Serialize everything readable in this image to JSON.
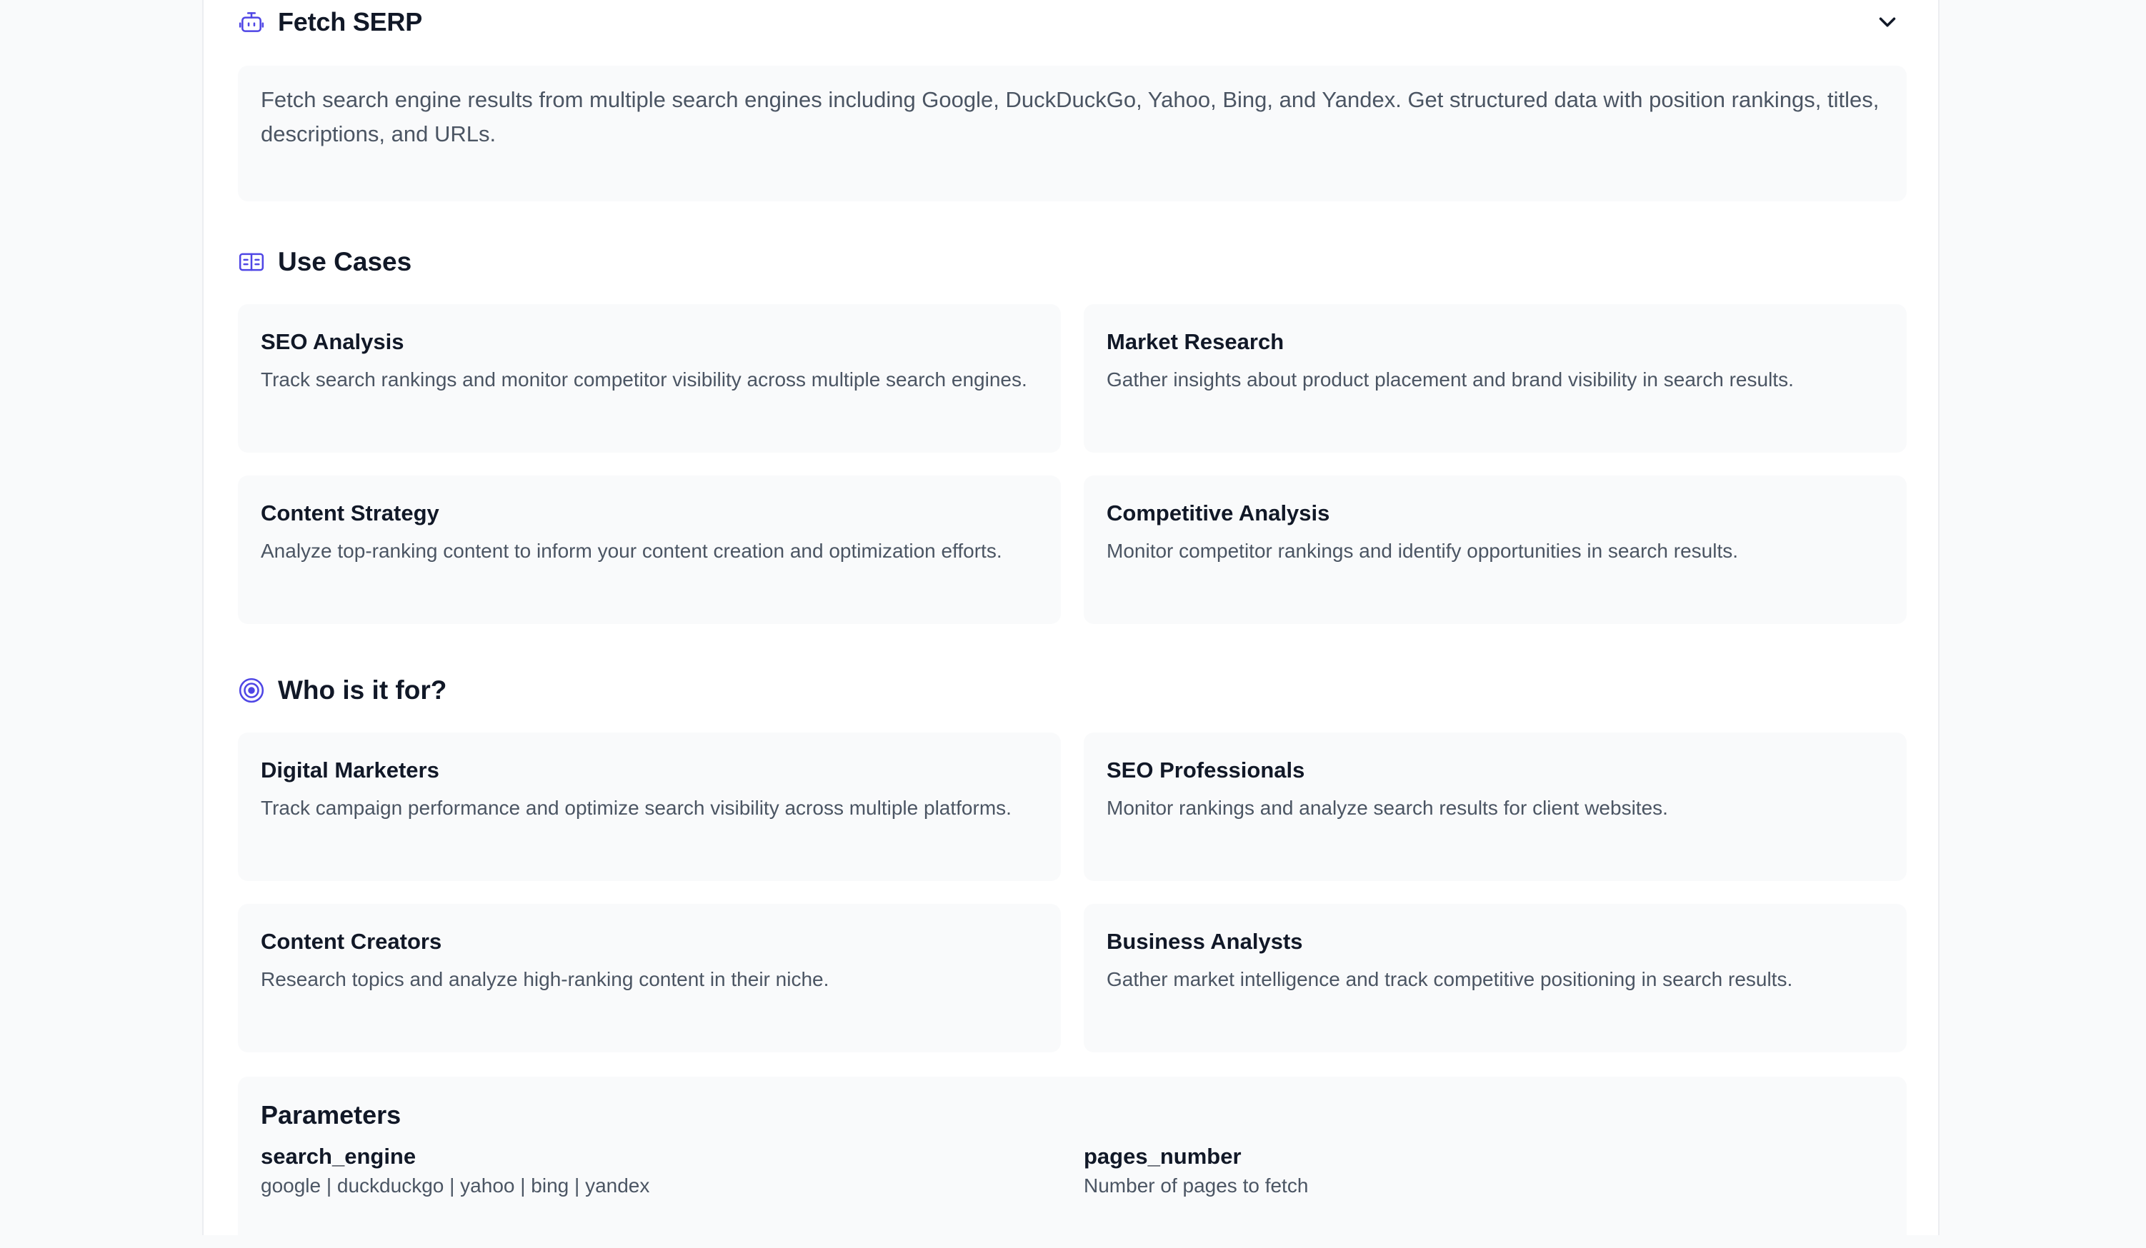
{
  "header": {
    "title": "Fetch SERP",
    "icon": "robot-icon",
    "toggle_icon": "chevron-down-icon"
  },
  "description": "Fetch search engine results from multiple search engines including Google, DuckDuckGo, Yahoo, Bing, and Yandex. Get structured data with position rankings, titles, descriptions, and URLs.",
  "use_cases": {
    "title": "Use Cases",
    "icon": "book-open-icon",
    "items": [
      {
        "title": "SEO Analysis",
        "text": "Track search rankings and monitor competitor visibility across multiple search engines."
      },
      {
        "title": "Market Research",
        "text": "Gather insights about product placement and brand visibility in search results."
      },
      {
        "title": "Content Strategy",
        "text": "Analyze top-ranking content to inform your content creation and optimization efforts."
      },
      {
        "title": "Competitive Analysis",
        "text": "Monitor competitor rankings and identify opportunities in search results."
      }
    ]
  },
  "audience": {
    "title": "Who is it for?",
    "icon": "target-icon",
    "items": [
      {
        "title": "Digital Marketers",
        "text": "Track campaign performance and optimize search visibility across multiple platforms."
      },
      {
        "title": "SEO Professionals",
        "text": "Monitor rankings and analyze search results for client websites."
      },
      {
        "title": "Content Creators",
        "text": "Research topics and analyze high-ranking content in their niche."
      },
      {
        "title": "Business Analysts",
        "text": "Gather market intelligence and track competitive positioning in search results."
      }
    ]
  },
  "parameters": {
    "title": "Parameters",
    "items": [
      {
        "name": "search_engine",
        "desc": "google | duckduckgo | yahoo | bing | yandex"
      },
      {
        "name": "pages_number",
        "desc": "Number of pages to fetch"
      }
    ]
  },
  "colors": {
    "accent": "#4f46e5",
    "card_bg": "#f9fafb",
    "text_muted": "#4b5563"
  }
}
